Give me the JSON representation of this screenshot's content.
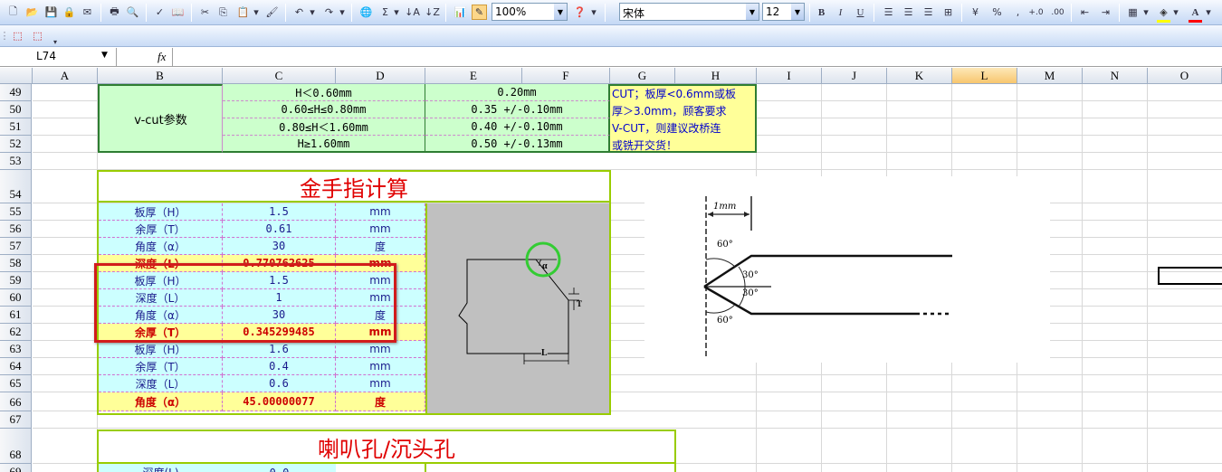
{
  "toolbar": {
    "zoom": "100%",
    "font_name": "宋体",
    "font_size": "12"
  },
  "formula_bar": {
    "cell_ref": "L74",
    "fx": "fx"
  },
  "columns": [
    "A",
    "B",
    "C",
    "D",
    "E",
    "F",
    "G",
    "H",
    "I",
    "J",
    "K",
    "L",
    "M",
    "N",
    "O"
  ],
  "rows": [
    "49",
    "50",
    "51",
    "52",
    "53",
    "54",
    "55",
    "56",
    "57",
    "58",
    "59",
    "60",
    "61",
    "62",
    "63",
    "64",
    "65",
    "66",
    "67",
    "68",
    "69"
  ],
  "vcut": {
    "label": "v-cut参数",
    "ranges": [
      "H＜0.60mm",
      "0.60≤H≤0.80mm",
      "0.80≤H＜1.60mm",
      "H≥1.60mm"
    ],
    "values": [
      "0.20mm",
      "0.35 +/-0.10mm",
      "0.40 +/-0.10mm",
      "0.50 +/-0.13mm"
    ],
    "note": [
      "CUT；板厚<0.6mm或板",
      "厚＞3.0mm，顾客要求",
      "V-CUT，则建议改桥连",
      "或铣开交货！"
    ]
  },
  "gold": {
    "title": "金手指计算",
    "rows": [
      {
        "label": "板厚（H）",
        "value": "1.5",
        "unit": "mm",
        "style": "cy"
      },
      {
        "label": "余厚（T）",
        "value": "0.61",
        "unit": "mm",
        "style": "cy"
      },
      {
        "label": "角度（α）",
        "value": "30",
        "unit": "度",
        "style": "cy"
      },
      {
        "label": "深度（L）",
        "value": "0.770762625",
        "unit": "mm",
        "style": "ye"
      },
      {
        "label": "板厚（H）",
        "value": "1.5",
        "unit": "mm",
        "style": "cy"
      },
      {
        "label": "深度（L）",
        "value": "1",
        "unit": "mm",
        "style": "cy"
      },
      {
        "label": "角度（α）",
        "value": "30",
        "unit": "度",
        "style": "cy"
      },
      {
        "label": "余厚（T）",
        "value": "0.345299485",
        "unit": "mm",
        "style": "ye"
      },
      {
        "label": "板厚（H）",
        "value": "1.6",
        "unit": "mm",
        "style": "cy"
      },
      {
        "label": "余厚（T）",
        "value": "0.4",
        "unit": "mm",
        "style": "cy"
      },
      {
        "label": "深度（L）",
        "value": "0.6",
        "unit": "mm",
        "style": "cy"
      },
      {
        "label": "角度（α）",
        "value": "45.00000077",
        "unit": "度",
        "style": "ye"
      }
    ],
    "diagram": {
      "alpha": "α",
      "t": "T",
      "l": "L"
    }
  },
  "sketch": {
    "dim": "1mm",
    "a1": "60°",
    "a2": "30°",
    "a3": "30°",
    "a4": "60°"
  },
  "horn": {
    "title": "喇叭孔/沉头孔",
    "row_label": "深度(L)",
    "row_value": "0.0"
  }
}
